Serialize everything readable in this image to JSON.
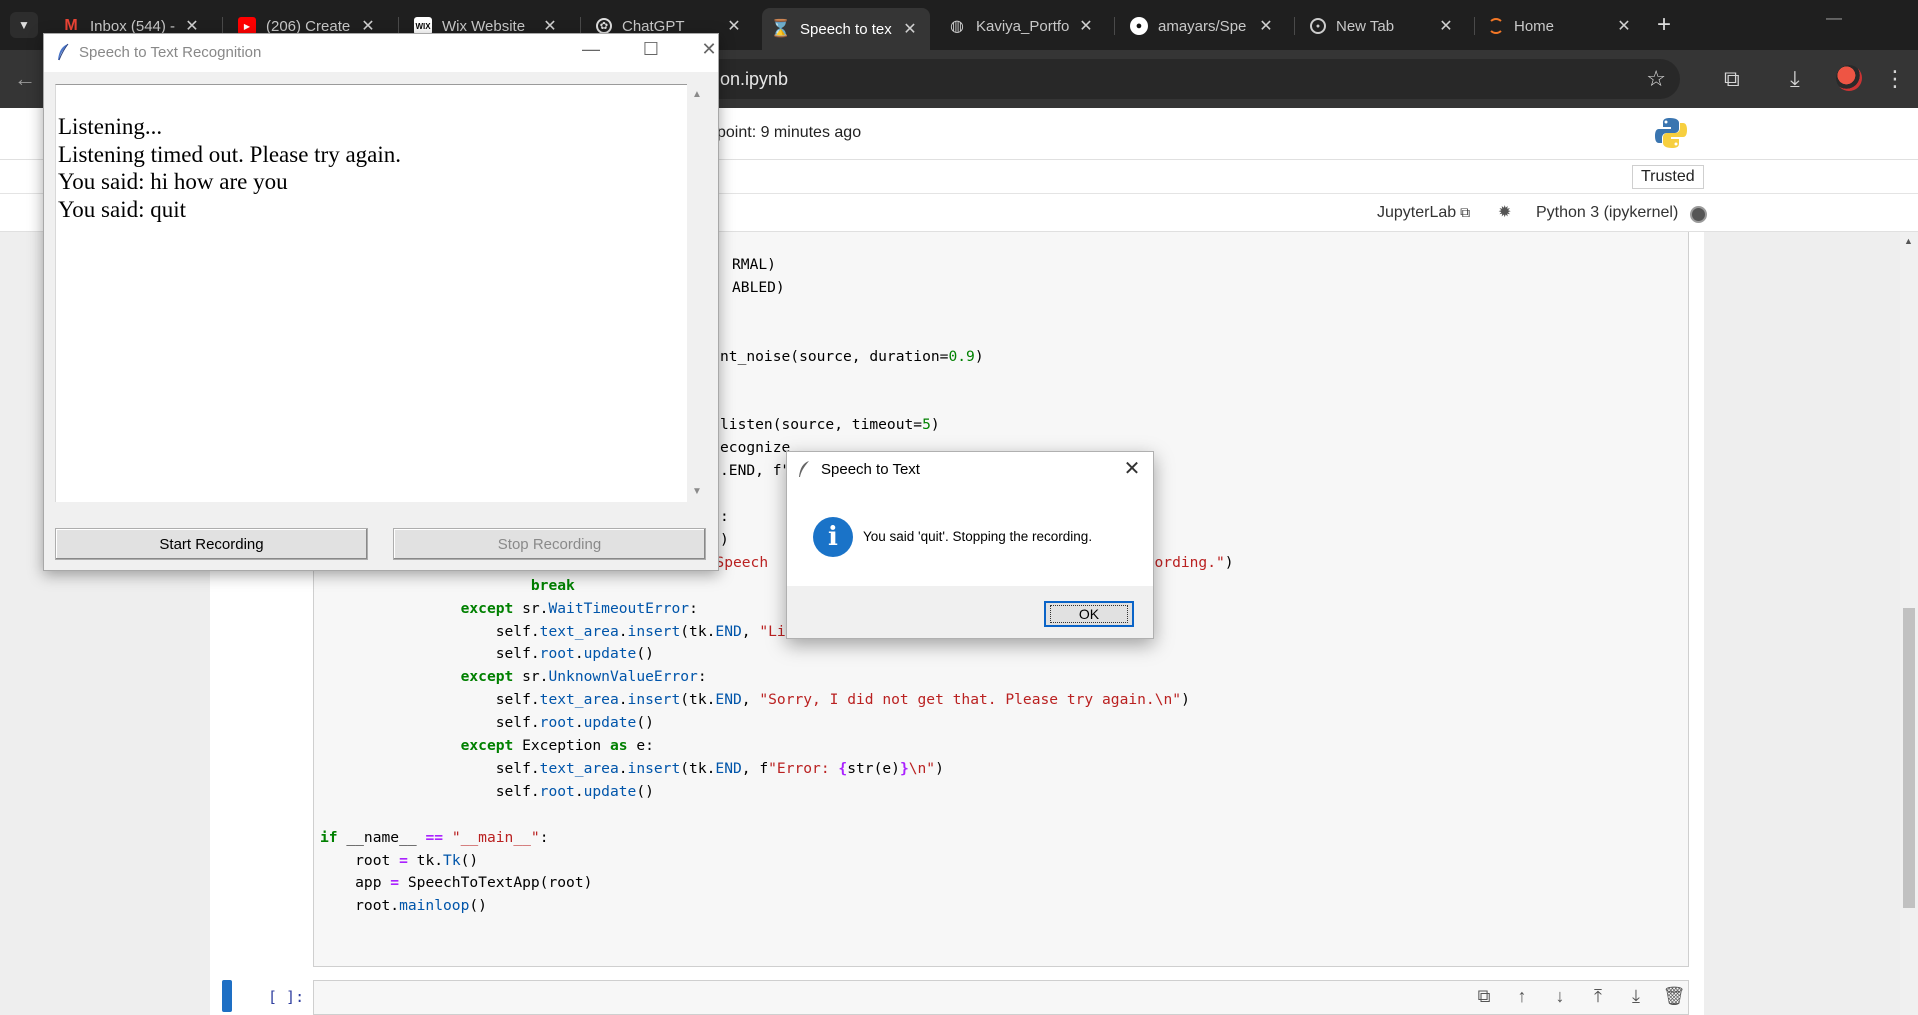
{
  "browser": {
    "tabs": [
      {
        "title": "Inbox (544) -",
        "icon": "gmail-icon"
      },
      {
        "title": "(206) Create",
        "icon": "youtube-icon"
      },
      {
        "title": "Wix Website",
        "icon": "wix-icon"
      },
      {
        "title": "ChatGPT",
        "icon": "chatgpt-icon"
      },
      {
        "title": "Speech to tex",
        "icon": "hourglass-icon",
        "active": true
      },
      {
        "title": "Kaviya_Portfo",
        "icon": "globe-icon"
      },
      {
        "title": "amayars/Spe",
        "icon": "github-icon"
      },
      {
        "title": "New Tab",
        "icon": "chrome-icon"
      },
      {
        "title": "Home",
        "icon": "jupyter-icon"
      }
    ],
    "url": "on.ipynb"
  },
  "jupyter": {
    "checkpoint": "point: 9 minutes ago",
    "trusted": "Trusted",
    "jupyterlab_link": "JupyterLab",
    "kernel": "Python 3 (ipykernel)",
    "new_cell_prompt": "[ ]:"
  },
  "tk_window": {
    "title": "Speech to Text Recognition",
    "lines": [
      "Listening...",
      "Listening timed out. Please try again.",
      "You said: hi how are you",
      "You said: quit"
    ],
    "start_button": "Start Recording",
    "stop_button": "Stop Recording"
  },
  "messagebox": {
    "title": "Speech to Text",
    "message": "You said 'quit'. Stopping the recording.",
    "ok": "OK"
  },
  "colors": {
    "accent": "#1a73c8",
    "jupyter_orange": "#f37726",
    "code_keyword": "#008000",
    "code_string": "#ba2121"
  }
}
